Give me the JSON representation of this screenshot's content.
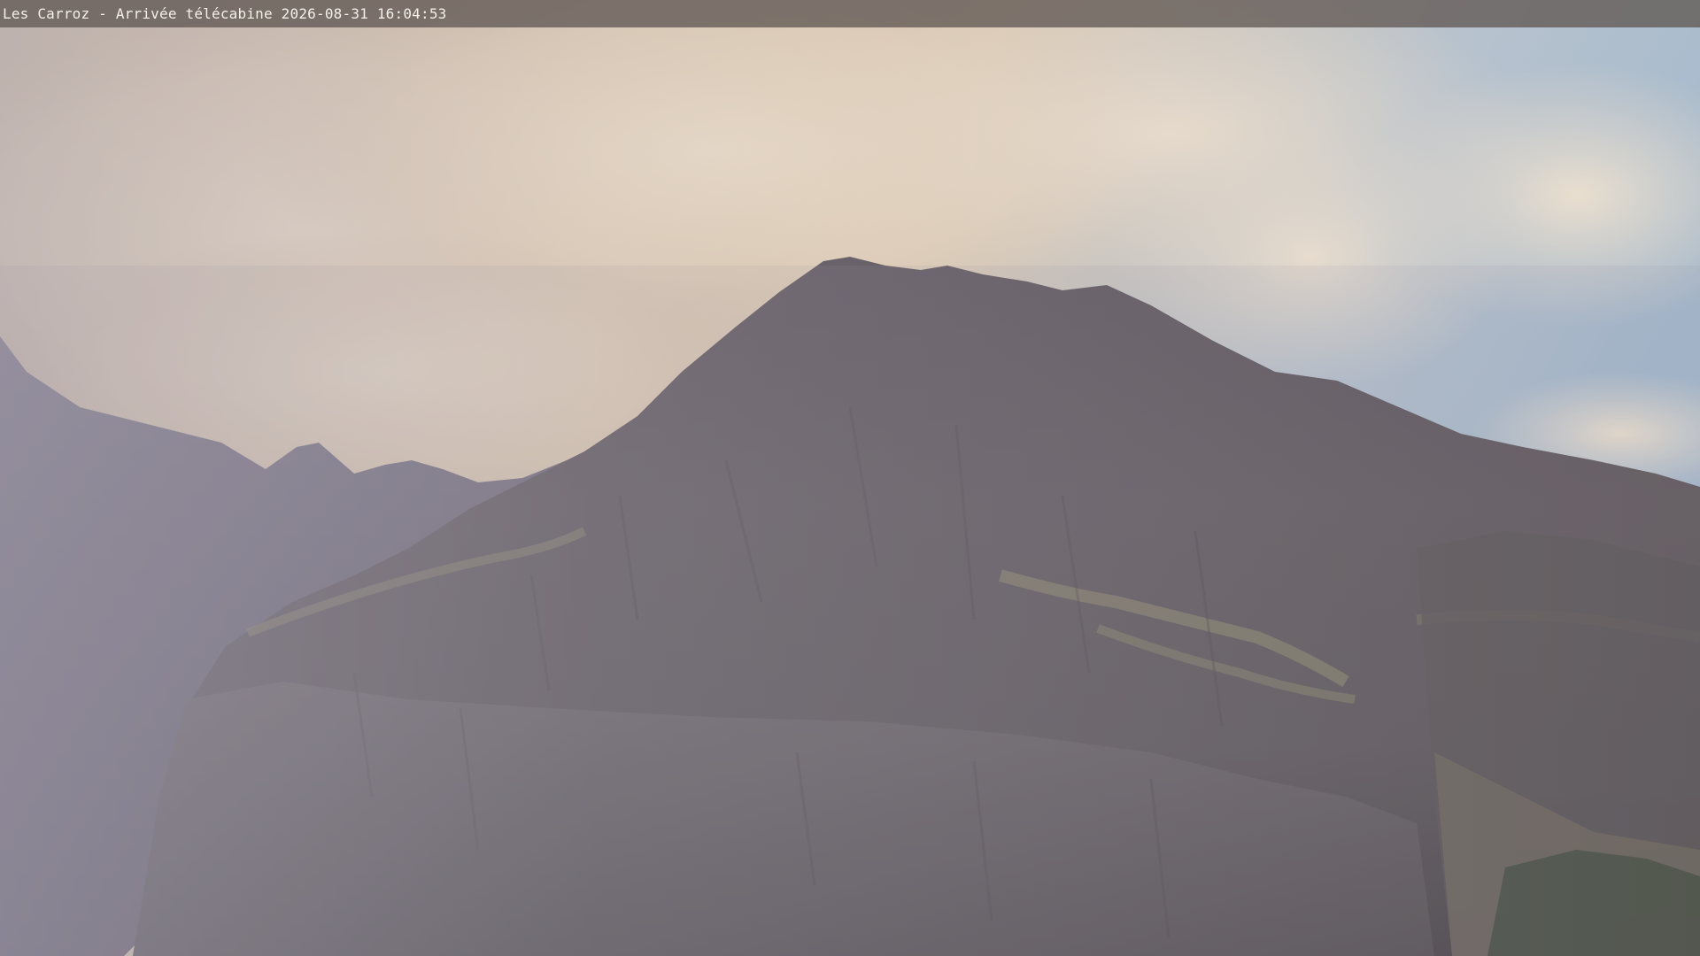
{
  "caption": {
    "location": "Les Carroz - Arrivée télécabine",
    "timestamp": "2026-08-31 16:04:53"
  },
  "scene": {
    "subject": "mountain-peak-webcam-view",
    "colors": {
      "sky_blue": "#a9bccd",
      "cloud_warm": "#efdcc0",
      "rock_dark": "#4b4650",
      "rock_mid": "#6a6468",
      "grass": "#8d8a6c"
    }
  }
}
